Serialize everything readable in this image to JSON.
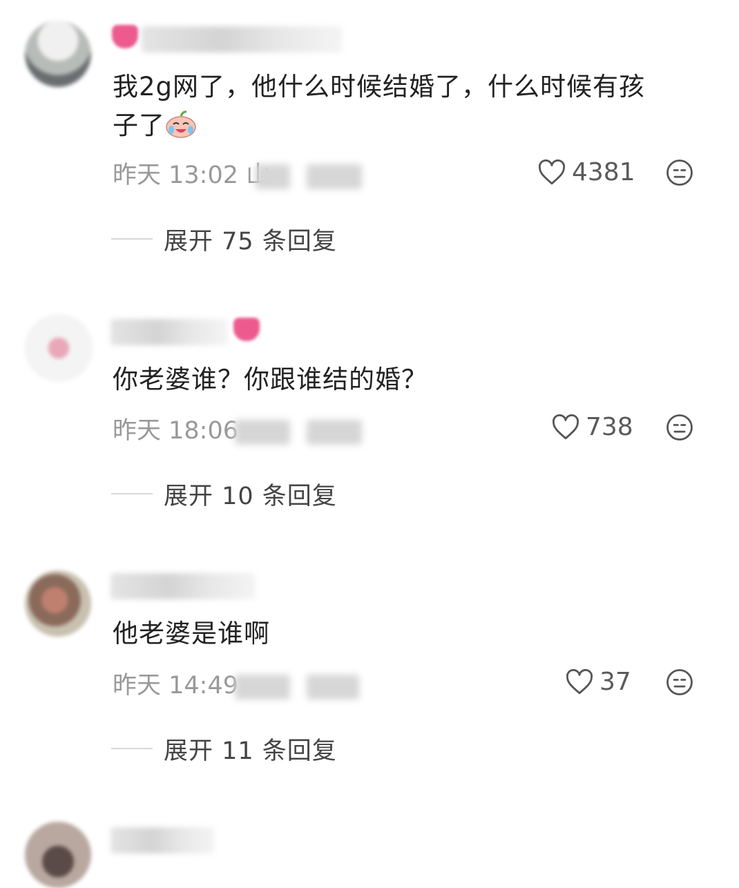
{
  "comments": [
    {
      "text_line1": "我2g网了，他什么时候结婚了，什么时候有孩",
      "text_line2": "子了",
      "time": "昨天 13:02 山",
      "likes": "4381",
      "expand": "展开 75 条回复"
    },
    {
      "text_line1": "你老婆谁？你跟谁结的婚？",
      "time": "昨天 18:06",
      "likes": "738",
      "expand": "展开 10 条回复"
    },
    {
      "text_line1": "他老婆是谁啊",
      "time": "昨天 14:49",
      "likes": "37",
      "expand": "展开 11 条回复"
    }
  ],
  "icons": {
    "like": "heart-outline-icon",
    "dislike": "meh-face-icon",
    "emoji": "crying-laughing-emoji"
  },
  "colors": {
    "text": "#222222",
    "meta": "#999999",
    "expand": "#444444",
    "badge": "#ec5a8e"
  }
}
